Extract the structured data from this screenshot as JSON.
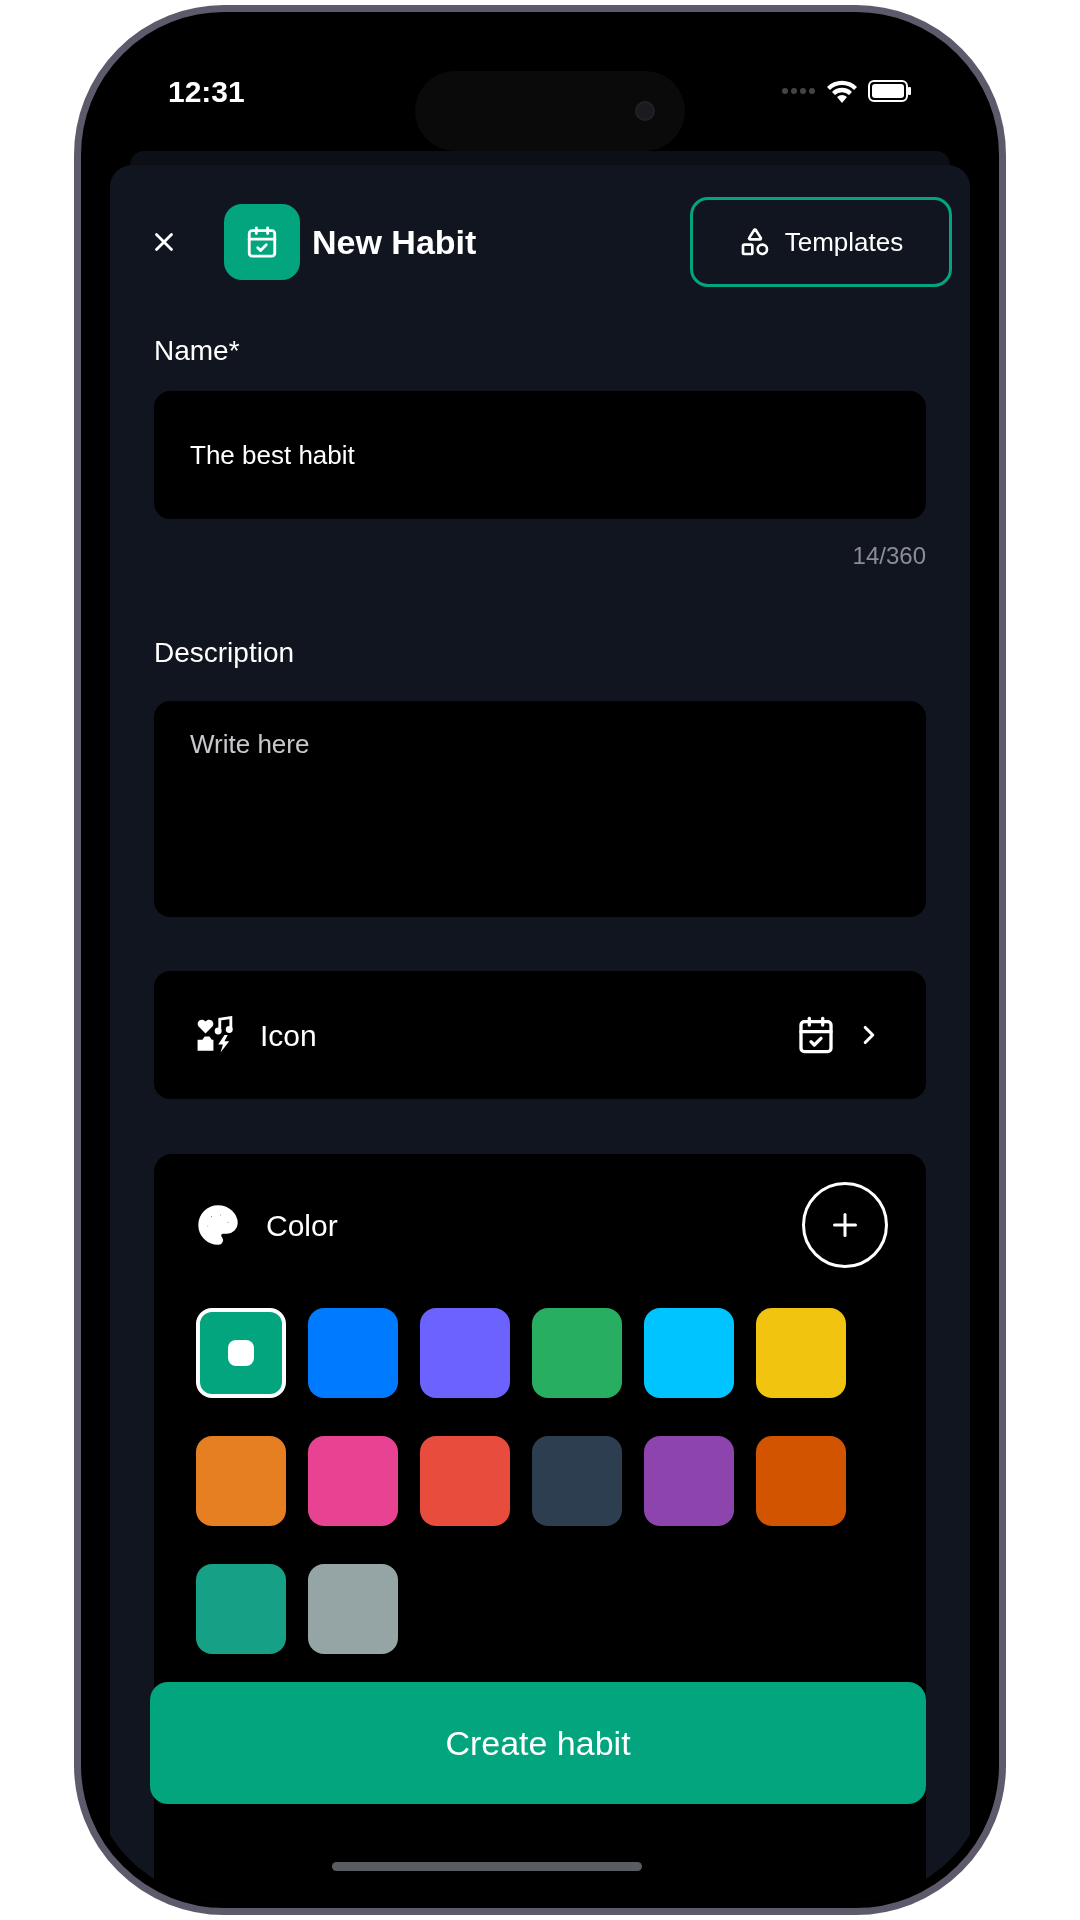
{
  "status_bar": {
    "time": "12:31"
  },
  "header": {
    "title": "New Habit",
    "templates_button": "Templates"
  },
  "name_field": {
    "label": "Name*",
    "value": "The best habit",
    "counter": "14/360"
  },
  "description_field": {
    "label": "Description",
    "placeholder": "Write here"
  },
  "icon_row": {
    "label": "Icon"
  },
  "color_section": {
    "label": "Color",
    "swatches": [
      {
        "color": "#02a57e",
        "selected": true
      },
      {
        "color": "#007aff",
        "selected": false
      },
      {
        "color": "#6c63ff",
        "selected": false
      },
      {
        "color": "#27ae60",
        "selected": false
      },
      {
        "color": "#00c4ff",
        "selected": false
      },
      {
        "color": "#f1c40f",
        "selected": false
      },
      {
        "color": "#e67e22",
        "selected": false
      },
      {
        "color": "#e84393",
        "selected": false
      },
      {
        "color": "#e74c3c",
        "selected": false
      },
      {
        "color": "#2c3e50",
        "selected": false
      },
      {
        "color": "#8e44ad",
        "selected": false
      },
      {
        "color": "#d35400",
        "selected": false
      },
      {
        "color": "#16a085",
        "selected": false
      },
      {
        "color": "#95a5a6",
        "selected": false
      }
    ]
  },
  "create_button": "Create habit"
}
